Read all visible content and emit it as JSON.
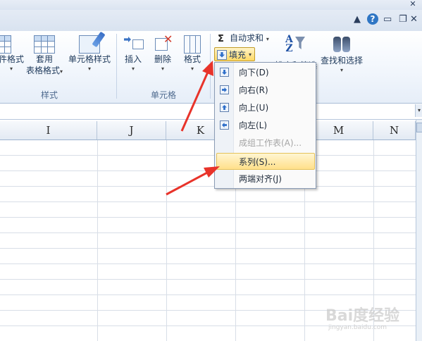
{
  "window": {
    "controls": [
      "▲",
      "?",
      "❐",
      "✕"
    ]
  },
  "ribbon": {
    "styles_group": {
      "label": "样式",
      "partial_button": "件格式",
      "table_format_line1": "套用",
      "table_format_line2": "表格格式",
      "cell_style": "单元格样式"
    },
    "cells_group": {
      "label": "单元格",
      "insert": "插入",
      "delete": "删除",
      "format": "格式"
    },
    "editing_group": {
      "autosum": "自动求和",
      "fill": "填充",
      "sort_filter_partial": "排序和筛选",
      "find_select": "查找和选择"
    }
  },
  "fill_menu": {
    "items": [
      {
        "label": "向下(D)",
        "icon": "fill-down-icon",
        "disabled": false,
        "active": false
      },
      {
        "label": "向右(R)",
        "icon": "fill-right-icon",
        "disabled": false,
        "active": false
      },
      {
        "label": "向上(U)",
        "icon": "fill-up-icon",
        "disabled": false,
        "active": false
      },
      {
        "label": "向左(L)",
        "icon": "fill-left-icon",
        "disabled": false,
        "active": false
      },
      {
        "label": "成组工作表(A)...",
        "icon": "",
        "disabled": true,
        "active": false
      },
      {
        "label": "系列(S)...",
        "icon": "",
        "disabled": false,
        "active": true
      },
      {
        "label": "两端对齐(J)",
        "icon": "",
        "disabled": false,
        "active": false
      }
    ]
  },
  "sheet": {
    "columns": [
      "I",
      "J",
      "K",
      "L",
      "M",
      "N"
    ]
  },
  "annotation": {
    "arrow_color": "#e8332a"
  },
  "watermark": {
    "text": "Bai度经验",
    "sub": "jingyan.baidu.com"
  }
}
